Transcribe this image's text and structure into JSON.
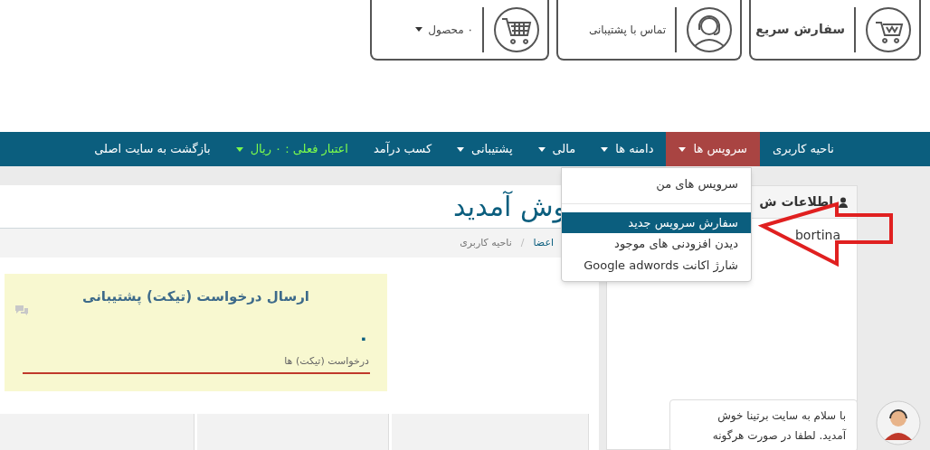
{
  "top_buttons": [
    {
      "kind": "order",
      "label": "سفارش سریع"
    },
    {
      "kind": "support",
      "label": "تماس با پشتیبانی"
    },
    {
      "kind": "cart",
      "label": "۰ محصول"
    }
  ],
  "nav": {
    "items": [
      {
        "label": "ناحیه کاربری",
        "dropdown": false,
        "selected": false,
        "highlight": false
      },
      {
        "label": "سرویس ها",
        "dropdown": true,
        "selected": true,
        "highlight": false
      },
      {
        "label": "دامنه ها",
        "dropdown": true,
        "selected": false,
        "highlight": false
      },
      {
        "label": "مالی",
        "dropdown": true,
        "selected": false,
        "highlight": false
      },
      {
        "label": "پشتیبانی",
        "dropdown": true,
        "selected": false,
        "highlight": false
      },
      {
        "label": "کسب درآمد",
        "dropdown": false,
        "selected": false,
        "highlight": false
      },
      {
        "label": "اعتبار فعلی : ۰ ریال",
        "dropdown": true,
        "selected": false,
        "highlight": true
      },
      {
        "label": "بازگشت به سایت اصلی",
        "dropdown": false,
        "selected": false,
        "highlight": false
      }
    ]
  },
  "dropdown_menu": {
    "groups": [
      [
        {
          "label": "سرویس های من",
          "selected": false
        }
      ],
      [
        {
          "label": "سفارش سرویس جدید",
          "selected": true
        },
        {
          "label": "دیدن افزودنی های موجود",
          "selected": false
        },
        {
          "label": "شارژ اکانت Google adwords",
          "selected": false
        }
      ]
    ]
  },
  "page": {
    "title": "وش آمدید",
    "breadcrumb_separator": "/",
    "breadcrumb": [
      {
        "label": "اعضا",
        "link": true
      },
      {
        "label": "ناحیه کاربری",
        "link": false
      }
    ]
  },
  "ticket_card": {
    "title": "ارسال درخواست (تیکت) پشتیبانی",
    "count": "۰",
    "label": "درخواست (تیکت) ها"
  },
  "side_panel": {
    "title": "اطلاعات ش",
    "text": "bortina"
  },
  "chat": {
    "lines": [
      "با سلام به سایت برتینا خوش",
      "آمدید. لطفا در صورت هرگونه"
    ]
  }
}
